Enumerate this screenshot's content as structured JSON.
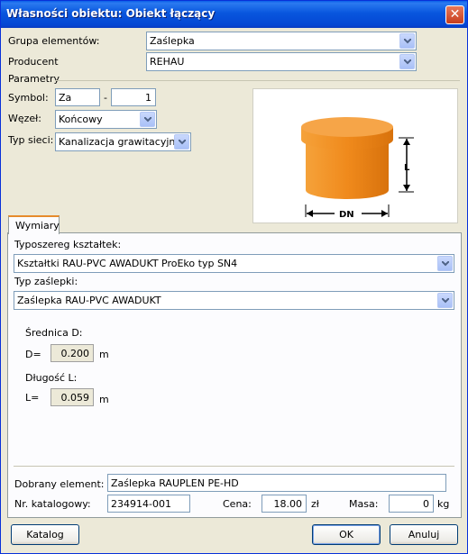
{
  "window": {
    "title": "Własności obiektu: Obiekt łączący",
    "close_glyph": "✕"
  },
  "group": {
    "label": "Grupa elementów:",
    "value": "Zaślepka"
  },
  "producer": {
    "label": "Producent",
    "value": "REHAU"
  },
  "params": {
    "title": "Parametry",
    "symbol_label": "Symbol:",
    "symbol_value": "Za",
    "symbol_sep": "-",
    "symbol_num": "1",
    "node_label": "Węzeł:",
    "node_value": "Końcowy",
    "network_label": "Typ sieci:",
    "network_value": "Kanalizacja grawitacyjna"
  },
  "preview": {
    "label_l": "L",
    "label_dn": "DN",
    "body_color": "#f08a1c"
  },
  "tabs": [
    {
      "label": "Wymiary"
    }
  ],
  "dims": {
    "series_label": "Typoszereg kształtek:",
    "series_value": "Kształtki RAU-PVC AWADUKT ProEko typ SN4",
    "cap_type_label": "Typ zaślepki:",
    "cap_type_value": "Zaślepka RAU-PVC AWADUKT",
    "diameter_title": "Średnica D:",
    "diameter_label": "D=",
    "diameter_value": "0.200",
    "diameter_unit": "m",
    "length_title": "Długość L:",
    "length_label": "L=",
    "length_value": "0.059",
    "length_unit": "m"
  },
  "selected": {
    "label": "Dobrany element:",
    "value": "Zaślepka RAUPLEN PE-HD",
    "catalog_label": "Nr. katalogowy:",
    "catalog_value": "234914-001",
    "price_label": "Cena:",
    "price_value": "18.00",
    "price_unit": "zł",
    "mass_label": "Masa:",
    "mass_value": "0",
    "mass_unit": "kg"
  },
  "buttons": {
    "catalog": "Katalog",
    "ok": "OK",
    "cancel": "Anuluj"
  }
}
